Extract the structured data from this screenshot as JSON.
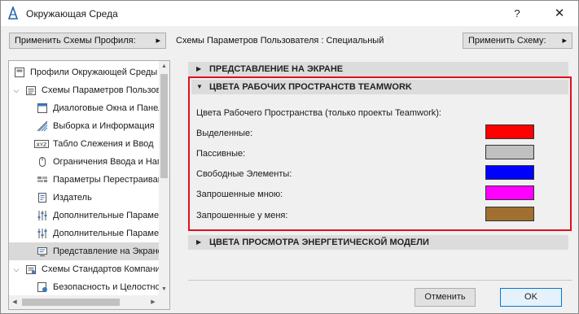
{
  "window": {
    "title": "Окружающая Среда",
    "help_glyph": "?",
    "close_glyph": "✕"
  },
  "toolbar": {
    "apply_profile_label": "Применить Схемы Профиля:",
    "apply_profile_caret": "▸",
    "user_schemes_text": "Схемы Параметров Пользователя :  Специальный",
    "apply_scheme_label": "Применить Схему:",
    "apply_scheme_caret": "▸"
  },
  "tree": {
    "items": [
      {
        "label": "Профили Окружающей Среды",
        "icon": "profiles-icon"
      },
      {
        "label": "Схемы Параметров Пользователя",
        "icon": "user-schemes-icon",
        "expanded": true
      },
      {
        "label": "Диалоговые Окна и Панели",
        "icon": "dialogs-icon"
      },
      {
        "label": "Выборка и Информация",
        "icon": "selection-icon"
      },
      {
        "label": "Табло Слежения и Ввод",
        "icon": "xyz-tracker-icon",
        "icon_text": "XYZ"
      },
      {
        "label": "Ограничения Ввода и Направляющие",
        "icon": "mouse-icon"
      },
      {
        "label": "Параметры Перестраивания",
        "icon": "rebuild-icon"
      },
      {
        "label": "Издатель",
        "icon": "publisher-icon"
      },
      {
        "label": "Дополнительные Параметры",
        "icon": "sliders-icon"
      },
      {
        "label": "Дополнительные Параметры",
        "icon": "sliders-icon"
      },
      {
        "label": "Представление на Экране",
        "icon": "screen-icon",
        "selected": true
      },
      {
        "label": "Схемы Стандартов Компании",
        "icon": "company-schemes-icon",
        "expanded": true
      },
      {
        "label": "Безопасность и Целостность",
        "icon": "security-icon"
      }
    ]
  },
  "sections": {
    "screen_view": "ПРЕДСТАВЛЕНИЕ НА ЭКРАНЕ",
    "teamwork_colors": "ЦВЕТА РАБОЧИХ ПРОСТРАНСТВ TEAMWORK",
    "energy_model": "ЦВЕТА ПРОСМОТРА ЭНЕРГЕТИЧЕСКОЙ МОДЕЛИ",
    "expand_glyph": "▶",
    "collapse_glyph": "▼"
  },
  "teamwork": {
    "intro": "Цвета Рабочего Пространства (только проекты Teamwork):",
    "rows": [
      {
        "label": "Выделенные:",
        "color": "#ff0000"
      },
      {
        "label": "Пассивные:",
        "color": "#c0c0c0"
      },
      {
        "label": "Свободные Элементы:",
        "color": "#0000ff"
      },
      {
        "label": "Запрошенные мною:",
        "color": "#ff00ff"
      },
      {
        "label": "Запрошенные у меня:",
        "color": "#a07030"
      }
    ]
  },
  "buttons": {
    "cancel": "Отменить",
    "ok": "OK"
  },
  "colors": {
    "highlight_border": "#e0101d",
    "default_button_border": "#0078d7"
  }
}
